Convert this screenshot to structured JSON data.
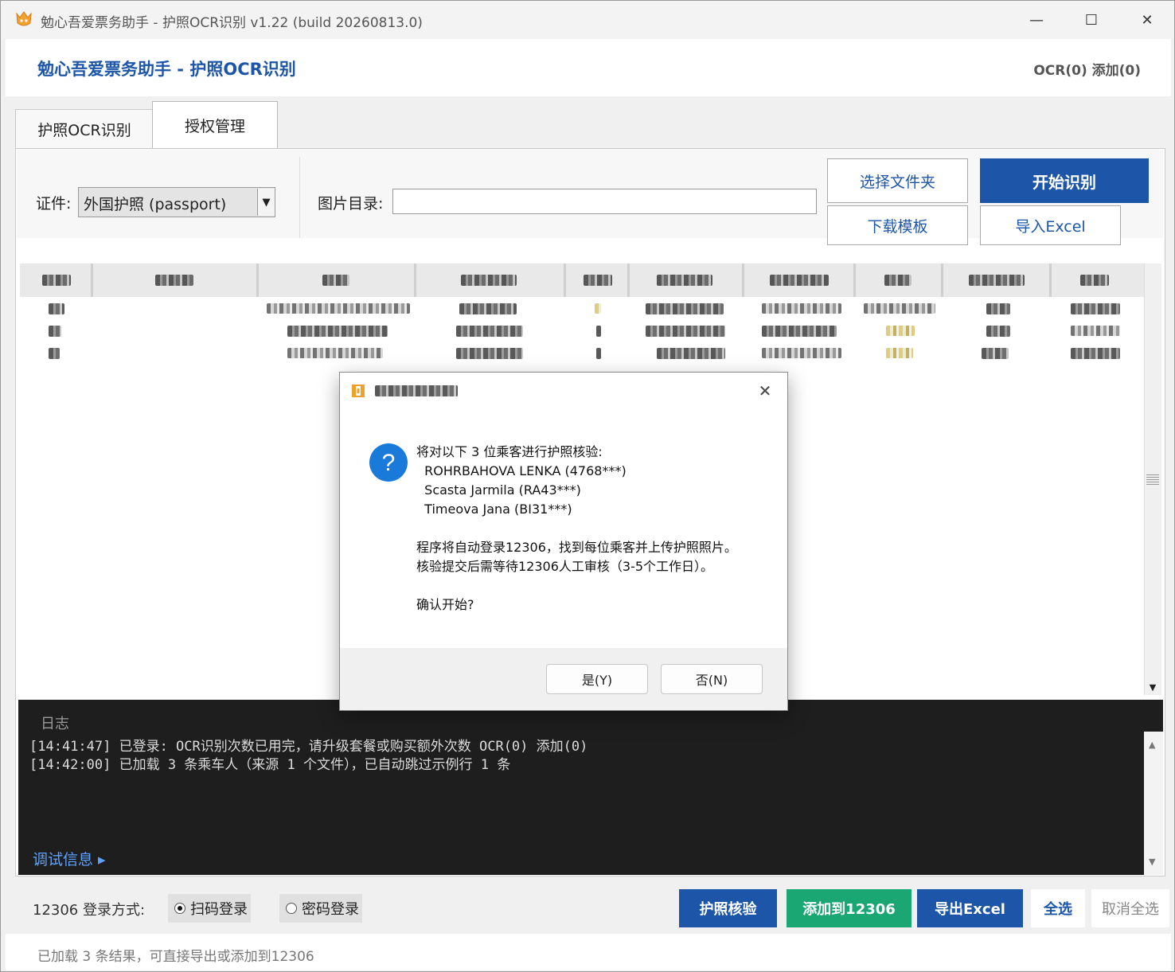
{
  "window": {
    "title": "勉心吾爱票务助手 - 护照OCR识别 v1.22 (build 20260813.0)",
    "controls": {
      "minimize": "—",
      "maximize": "☐",
      "close": "✕"
    }
  },
  "header": {
    "title": "勉心吾爱票务助手 - 护照OCR识别",
    "counter": "OCR(0) 添加(0)"
  },
  "tabs": [
    {
      "label": "护照OCR识别",
      "active": true
    },
    {
      "label": "授权管理",
      "active": false
    }
  ],
  "toolbar": {
    "cert_label": "证件:",
    "cert_value": "外国护照 (passport)",
    "dir_label": "图片目录:",
    "dir_value": "",
    "select_folder": "选择文件夹",
    "start": "开始识别",
    "download_template": "下载模板",
    "import_excel": "导入Excel"
  },
  "table": {
    "note": "",
    "rows": 3
  },
  "log": {
    "title": "日志",
    "lines": [
      "[14:41:47] 已登录: OCR识别次数已用完，请升级套餐或购买额外次数 OCR(0) 添加(0)",
      "[14:42:00] 已加载 3 条乘车人（来源 1 个文件），已自动跳过示例行 1 条"
    ],
    "debug_link": "调试信息 ▸"
  },
  "bottom": {
    "login_label": "12306 登录方式:",
    "radio_qr": "扫码登录",
    "radio_pwd": "密码登录",
    "verify": "护照核验",
    "add": "添加到12306",
    "export": "导出Excel",
    "select_all": "全选",
    "deselect_all": "取消全选"
  },
  "status": "已加载 3 条结果，可直接导出或添加到12306",
  "dialog": {
    "message": "将对以下 3 位乘客进行护照核验:\n  ROHRBAHOVA LENKA (4768***)\n  Scasta Jarmila (RA43***)\n  Timeova Jana (BI31***)\n\n程序将自动登录12306，找到每位乘客并上传护照照片。\n核验提交后需等待12306人工审核（3-5个工作日）。\n\n确认开始?",
    "yes": "是(Y)",
    "no": "否(N)"
  },
  "colors": {
    "brand_blue": "#1d56a8",
    "green": "#1aa774",
    "log_bg": "#1e1e1e"
  }
}
